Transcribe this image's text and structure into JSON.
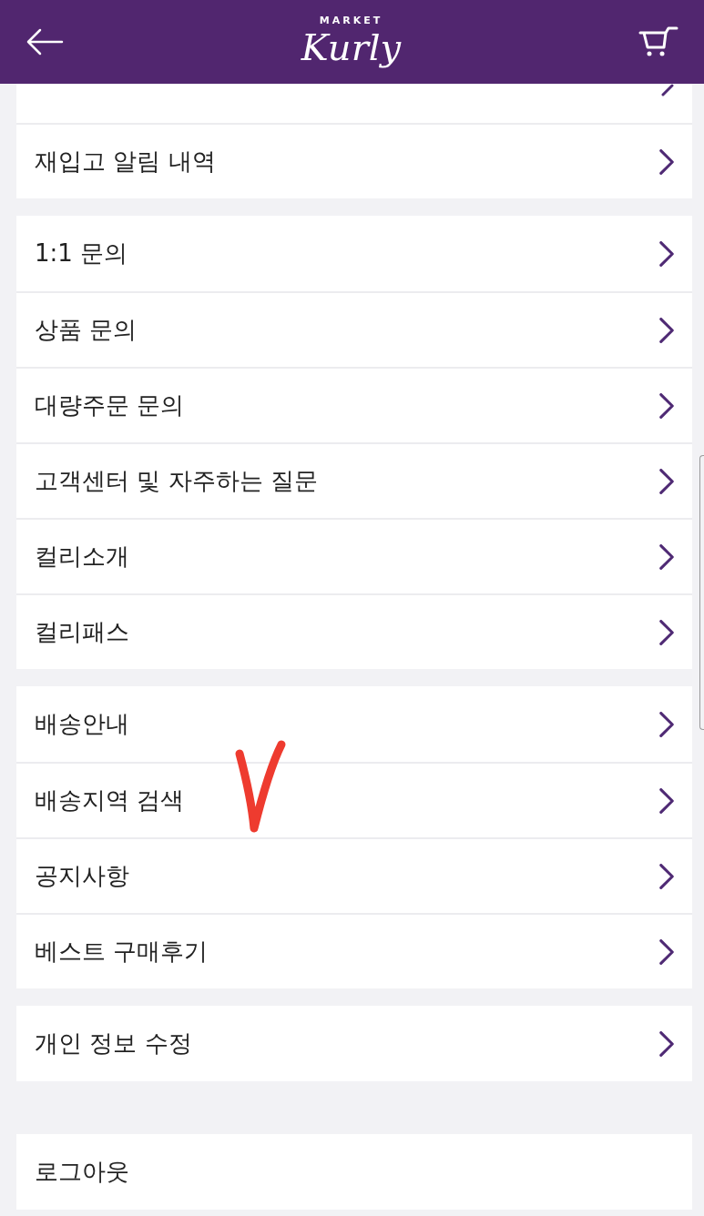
{
  "header": {
    "logo_top": "MARKET",
    "logo": "Kurly"
  },
  "groups": [
    {
      "items": [
        {
          "kind": "cut"
        },
        {
          "label": "재입고 알림 내역"
        }
      ]
    },
    {
      "items": [
        {
          "label": "1:1 문의"
        },
        {
          "label": "상품 문의"
        },
        {
          "label": "대량주문 문의"
        },
        {
          "label": "고객센터 및 자주하는 질문"
        },
        {
          "label": "컬리소개"
        },
        {
          "label": "컬리패스"
        }
      ]
    },
    {
      "items": [
        {
          "label": "배송안내"
        },
        {
          "label": "배송지역 검색"
        },
        {
          "label": "공지사항"
        },
        {
          "label": "베스트 구매후기"
        }
      ]
    },
    {
      "items": [
        {
          "label": "개인 정보 수정"
        }
      ]
    },
    {
      "items": [
        {
          "label": "로그아웃",
          "arrow": false
        }
      ]
    }
  ]
}
